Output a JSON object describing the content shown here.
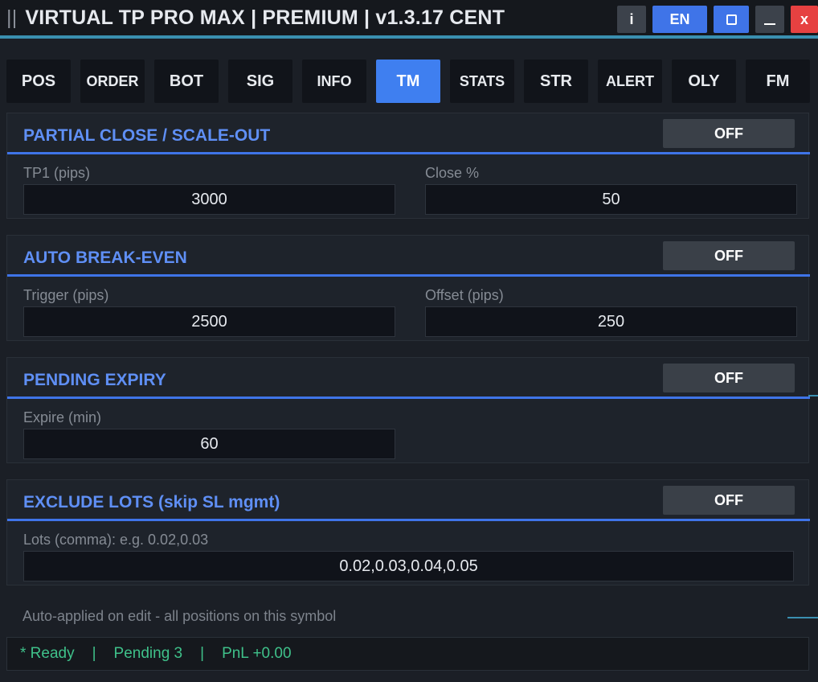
{
  "window": {
    "grip": "||",
    "title": "VIRTUAL TP PRO MAX | PREMIUM | v1.3.17  CENT",
    "buttons": {
      "info": "i",
      "language": "EN",
      "close": "x"
    }
  },
  "tabs": [
    {
      "label": "POS",
      "active": false
    },
    {
      "label": "ORDER",
      "active": false
    },
    {
      "label": "BOT",
      "active": false
    },
    {
      "label": "SIG",
      "active": false
    },
    {
      "label": "INFO",
      "active": false
    },
    {
      "label": "TM",
      "active": true
    },
    {
      "label": "STATS",
      "active": false
    },
    {
      "label": "STR",
      "active": false
    },
    {
      "label": "ALERT",
      "active": false
    },
    {
      "label": "OLY",
      "active": false
    },
    {
      "label": "FM",
      "active": false
    }
  ],
  "sections": {
    "partial_close": {
      "title": "PARTIAL CLOSE / SCALE-OUT",
      "toggle": "OFF",
      "tp1_label": "TP1 (pips)",
      "tp1_value": "3000",
      "close_pct_label": "Close %",
      "close_pct_value": "50"
    },
    "break_even": {
      "title": "AUTO BREAK-EVEN",
      "toggle": "OFF",
      "trigger_label": "Trigger (pips)",
      "trigger_value": "2500",
      "offset_label": "Offset (pips)",
      "offset_value": "250"
    },
    "pending_expiry": {
      "title": "PENDING EXPIRY",
      "toggle": "OFF",
      "expire_label": "Expire (min)",
      "expire_value": "60"
    },
    "exclude_lots": {
      "title": "EXCLUDE LOTS (skip SL mgmt)",
      "toggle": "OFF",
      "lots_label": "Lots (comma): e.g. 0.02,0.03",
      "lots_value": "0.02,0.03,0.04,0.05"
    }
  },
  "footnote": "Auto-applied on edit - all positions on this symbol",
  "status": {
    "ready": "* Ready",
    "sep": "|",
    "pending": "Pending 3",
    "pnl": "PnL +0.00"
  },
  "colors": {
    "accent": "#3f74e8",
    "active_tab": "#3f7ff0",
    "section_title": "#5f8ff5",
    "status_text": "#3fc18a",
    "close_button": "#e64141"
  }
}
